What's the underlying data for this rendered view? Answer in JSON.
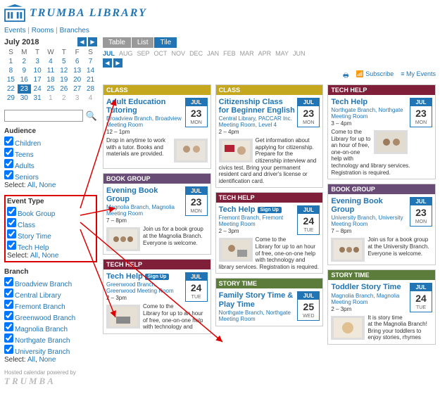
{
  "brand": "TRUMBA LIBRARY",
  "nav": {
    "events": "Events",
    "rooms": "Rooms",
    "branches": "Branches"
  },
  "calendar": {
    "title": "July 2018",
    "dow": [
      "S",
      "M",
      "T",
      "W",
      "T",
      "F",
      "S"
    ],
    "weeks": [
      [
        "1",
        "2",
        "3",
        "4",
        "5",
        "6",
        "7"
      ],
      [
        "8",
        "9",
        "10",
        "11",
        "12",
        "13",
        "14"
      ],
      [
        "15",
        "16",
        "17",
        "18",
        "19",
        "20",
        "21"
      ],
      [
        "22",
        "23",
        "24",
        "25",
        "26",
        "27",
        "28"
      ],
      [
        "29",
        "30",
        "31",
        "1",
        "2",
        "3",
        "4"
      ]
    ],
    "current": "23"
  },
  "search": {
    "placeholder": ""
  },
  "filters": {
    "select_label": "Select:",
    "all": "All",
    "none": "None",
    "audience": {
      "title": "Audience",
      "items": [
        "Children",
        "Teens",
        "Adults",
        "Seniors"
      ]
    },
    "event_type": {
      "title": "Event Type",
      "items": [
        "Book Group",
        "Class",
        "Story Time",
        "Tech Help"
      ]
    },
    "branch": {
      "title": "Branch",
      "items": [
        "Broadview Branch",
        "Central Library",
        "Fremont Branch",
        "Greenwood Branch",
        "Magnolia Branch",
        "Northgate Branch",
        "University Branch"
      ]
    }
  },
  "views": [
    "Table",
    "List",
    "Tile"
  ],
  "months": [
    "JUL",
    "AUG",
    "SEP",
    "OCT",
    "NOV",
    "DEC",
    "JAN",
    "FEB",
    "MAR",
    "APR",
    "MAY",
    "JUN"
  ],
  "util": {
    "print": "",
    "subscribe": "Subscribe",
    "myevents": "My Events"
  },
  "labels": {
    "signup": "Sign Up"
  },
  "cards": {
    "c1": {
      "cat": "CLASS",
      "title": "Adult Education Tutoring",
      "loc": "Broadview Branch, Broadview Meeting Room",
      "time": "12 – 1pm",
      "desc": "Drop in anytime to work with a tutor. Books and materials are provided.",
      "date": {
        "m": "JUL",
        "d": "23",
        "w": "MON"
      }
    },
    "c2": {
      "cat": "BOOK GROUP",
      "title": "Evening Book Group",
      "loc": "Magnolia Branch, Magnolia Meeting Room",
      "time": "7 – 8pm",
      "desc": "Join us for a book group at the Magnolia Branch. Everyone is welcome.",
      "date": {
        "m": "JUL",
        "d": "23",
        "w": "MON"
      }
    },
    "c3": {
      "cat": "TECH HELP",
      "title": "Tech Help",
      "loc": "Greenwood Branch, Greenwood Meeting Room",
      "time": "2 – 3pm",
      "desc": "Come to the Library for up to an hour of free, one-on-one help with technology and",
      "date": {
        "m": "JUL",
        "d": "24",
        "w": "TUE"
      }
    },
    "c4": {
      "cat": "CLASS",
      "title": "Citizenship Class for Beginner English",
      "loc": "Central Library, PACCAR Inc. Meeting Room, Level 4",
      "time": "2 – 4pm",
      "desc": "Get information about applying for citizenship. Prepare for the citizenship interview and civics test. Bring your permanent resident card and driver's license or identification card.",
      "date": {
        "m": "JUL",
        "d": "23",
        "w": "MON"
      }
    },
    "c5": {
      "cat": "TECH HELP",
      "title": "Tech Help",
      "loc": "Fremont Branch, Fremont Meeting Room",
      "time": "2 – 3pm",
      "desc": "Come to the Library for up to an hour of free, one-on-one help with technology and library services. Registration is required.",
      "date": {
        "m": "JUL",
        "d": "24",
        "w": "TUE"
      }
    },
    "c6": {
      "cat": "STORY TIME",
      "title": "Family Story Time & Play Time",
      "loc": "Northgate Branch, Northgate Meeting Room",
      "time": "",
      "desc": "",
      "date": {
        "m": "JUL",
        "d": "25",
        "w": "WED"
      }
    },
    "c7": {
      "cat": "TECH HELP",
      "title": "Tech Help",
      "loc": "Northgate Branch, Northgate Meeting Room",
      "time": "3 – 4pm",
      "desc": "Come to the Library for up to an hour of free, one-on-one help with technology and library services. Registration is required.",
      "date": {
        "m": "JUL",
        "d": "23",
        "w": "MON"
      }
    },
    "c8": {
      "cat": "BOOK GROUP",
      "title": "Evening Book Group",
      "loc": "University Branch, University Meeting Room",
      "time": "7 – 8pm",
      "desc": "Join us for a book group at the University Branch. Everyone is welcome.",
      "date": {
        "m": "JUL",
        "d": "23",
        "w": "MON"
      }
    },
    "c9": {
      "cat": "STORY TIME",
      "title": "Toddler Story Time",
      "loc": "Magnolia Branch, Magnolia Meeting Room",
      "time": "2 – 3pm",
      "desc": "It is story time at the Magnolia Branch! Bring your toddlers to enjoy stories, rhymes",
      "date": {
        "m": "JUL",
        "d": "24",
        "w": "TUE"
      }
    }
  },
  "powered": "Hosted calendar powered by",
  "powered_logo": "TRUMBA"
}
